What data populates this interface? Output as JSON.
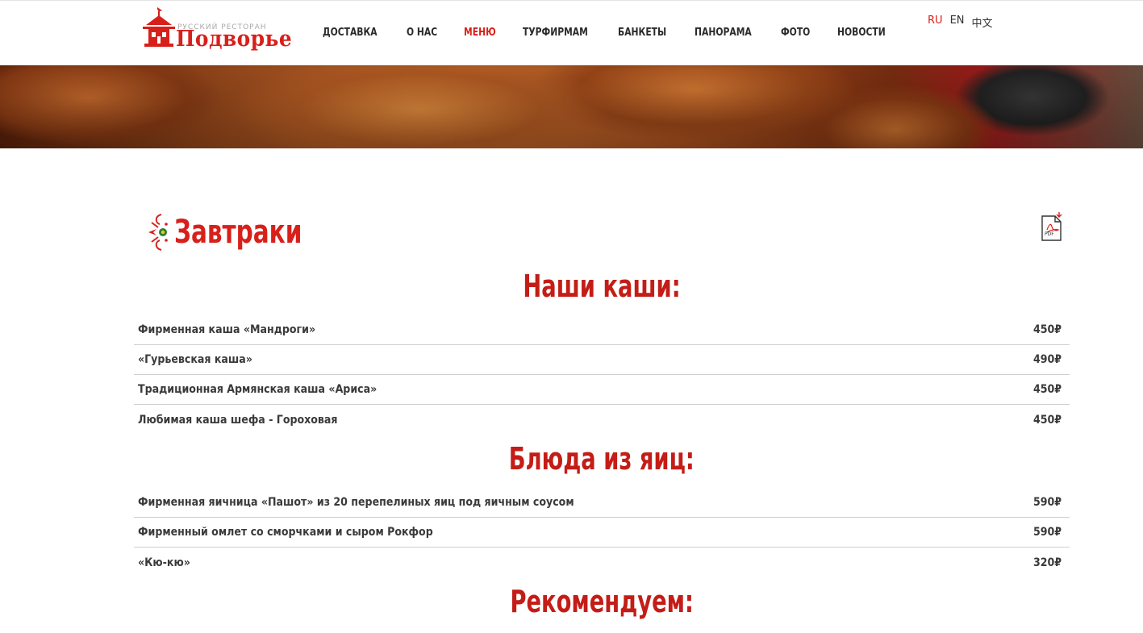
{
  "header": {
    "logo": {
      "subtitle": "РУССКИЙ РЕСТОРАН",
      "name": "Подворье"
    },
    "nav": [
      {
        "label": "ДОСТАВКА",
        "active": false
      },
      {
        "label": "О НАС",
        "active": false
      },
      {
        "label": "МЕНЮ",
        "active": true
      },
      {
        "label": "ТУРФИРМАМ",
        "active": false
      },
      {
        "label": "БАНКЕТЫ",
        "active": false
      },
      {
        "label": "ПАНОРАМА",
        "active": false
      },
      {
        "label": "ФОТО",
        "active": false
      },
      {
        "label": "НОВОСТИ",
        "active": false
      }
    ],
    "languages": [
      {
        "label": "RU",
        "active": true
      },
      {
        "label": "EN",
        "active": false
      },
      {
        "label": "中文",
        "active": false
      }
    ]
  },
  "section": {
    "title": "Завтраки",
    "pdf_icon": "pdf-download-icon",
    "pdf_label": "PDF"
  },
  "categories": [
    {
      "title": "Наши каши:",
      "items": [
        {
          "name": "Фирменная каша «Мандроги»",
          "price": "450₽"
        },
        {
          "name": "«Гурьевская каша»",
          "price": "490₽"
        },
        {
          "name": "Традиционная Армянская каша «Ариса»",
          "price": "450₽"
        },
        {
          "name": "Любимая каша шефа - Гороховая",
          "price": "450₽"
        }
      ]
    },
    {
      "title": "Блюда из яиц:",
      "items": [
        {
          "name": "Фирменная яичница «Пашот» из 20 перепелиных яиц под яичным соусом",
          "price": "590₽"
        },
        {
          "name": "Фирменный омлет со сморчками и сыром Рокфор",
          "price": "590₽"
        },
        {
          "name": "«Кю-кю»",
          "price": "320₽"
        }
      ]
    },
    {
      "title": "Рекомендуем:",
      "items": []
    }
  ],
  "colors": {
    "accent": "#d8201a",
    "text": "#3a3a3a",
    "divider": "#cfcfcf"
  }
}
